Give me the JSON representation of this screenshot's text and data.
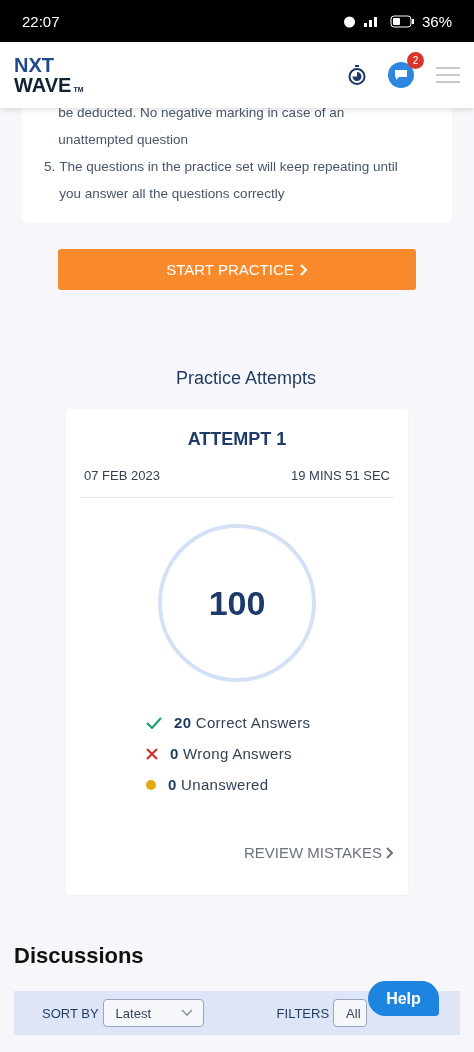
{
  "status_bar": {
    "time": "22:07",
    "battery": "36%"
  },
  "header": {
    "logo": {
      "line_1": "NXT",
      "line_2": "WAVE",
      "mark": "TM"
    },
    "notification_count": "2"
  },
  "instructions": [
    {
      "text": "be deducted. No negative marking in case of an unattempted question"
    },
    {
      "number": "5.",
      "text": "The questions in the practice set will keep repeating until you answer all the questions correctly"
    }
  ],
  "start_button": "START PRACTICE",
  "attempts_title": "Practice Attempts",
  "attempt": {
    "title": "ATTEMPT 1",
    "date": "07 FEB 2023",
    "duration": "19 MINS 51 SEC",
    "score": "100",
    "results": [
      {
        "kind": "correct",
        "text": "**20** Correct Answers"
      },
      {
        "kind": "wrong",
        "text": "**0** Wrong Answers"
      },
      {
        "kind": "unanswered",
        "text": "**0** Unanswered"
      }
    ],
    "review_link": "REVIEW MISTAKES"
  },
  "discussions": {
    "title": "Discussions",
    "sort_label": "SORT BY",
    "sort_value": "Latest",
    "filter_label": "FILTERS",
    "filter_value": "All"
  },
  "help_button": "Help"
}
